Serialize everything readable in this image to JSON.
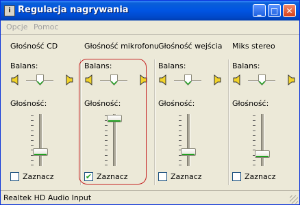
{
  "window": {
    "title": "Regulacja nagrywania",
    "controls": {
      "minimize": "_",
      "maximize": "□",
      "close": "✕"
    }
  },
  "menu": {
    "options": "Opcje",
    "help": "Pomoc"
  },
  "columns": [
    {
      "heading": "Głośność CD",
      "balance_label": "Balans:",
      "volume_label": "Głośność:",
      "balance": 0.5,
      "volume": 0.27,
      "select_label": "Zaznacz",
      "selected": false,
      "select_glyph": ""
    },
    {
      "heading": "Głośność mikrofonu",
      "balance_label": "Balans:",
      "volume_label": "Głośność:",
      "balance": 0.5,
      "volume": 0.95,
      "select_label": "Zaznacz",
      "selected": true,
      "select_glyph": "✔"
    },
    {
      "heading": "Głośność wejścia",
      "balance_label": "Balans:",
      "volume_label": "Głośność:",
      "balance": 0.5,
      "volume": 0.27,
      "select_label": "Zaznacz",
      "selected": false,
      "select_glyph": ""
    },
    {
      "heading": "Miks stereo",
      "balance_label": "Balans:",
      "volume_label": "Głośność:",
      "balance": 0.5,
      "volume": 0.22,
      "select_label": "Zaznacz",
      "selected": false,
      "select_glyph": ""
    }
  ],
  "statusbar": {
    "device": "Realtek HD Audio Input"
  },
  "colors": {
    "titlebar": "#0054e3",
    "face": "#ece9d8",
    "highlight": "#c41e1e",
    "thumb_accent": "#21a121"
  },
  "icons": {
    "app": "app-icon",
    "speaker_left": "speaker-left-icon",
    "speaker_right": "speaker-right-icon"
  }
}
